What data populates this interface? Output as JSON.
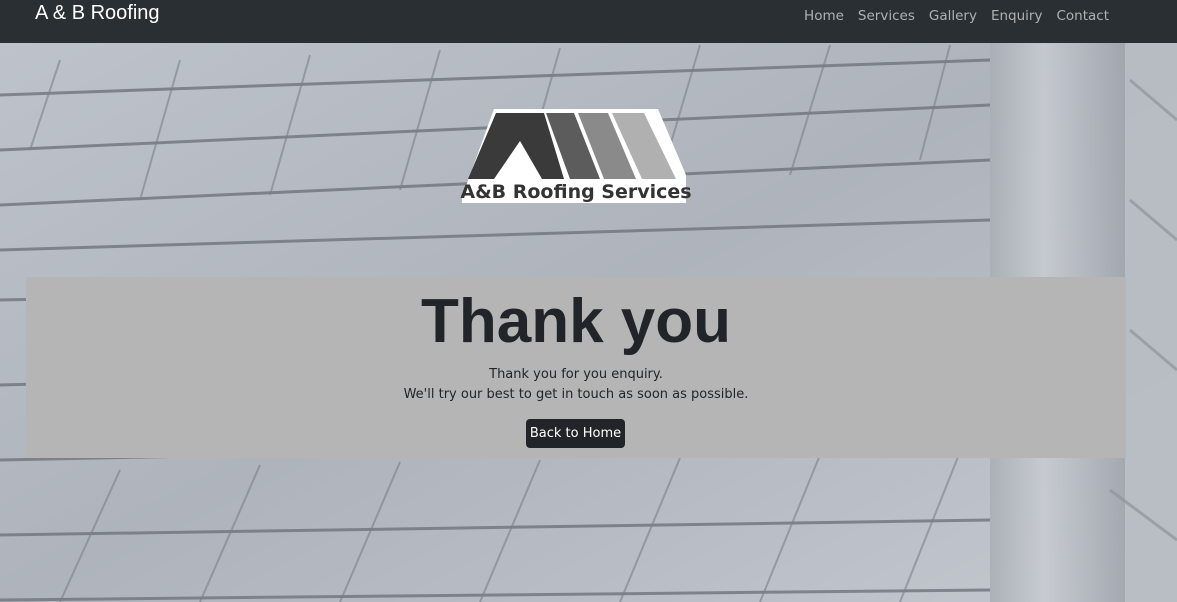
{
  "navbar": {
    "brand": "A & B Roofing",
    "links": [
      {
        "label": "Home"
      },
      {
        "label": "Services"
      },
      {
        "label": "Gallery"
      },
      {
        "label": "Enquiry"
      },
      {
        "label": "Contact"
      }
    ]
  },
  "logo": {
    "text": "A&B Roofing Services"
  },
  "main": {
    "title": "Thank you",
    "message_line1": "Thank you for you enquiry.",
    "message_line2": "We'll try our best to get in touch as soon as possible.",
    "back_button_label": "Back to Home"
  },
  "colors": {
    "navbar_bg": "#292f33",
    "panel_bg": "#b5b5b5",
    "button_bg": "#212529",
    "text_dark": "#212529"
  }
}
